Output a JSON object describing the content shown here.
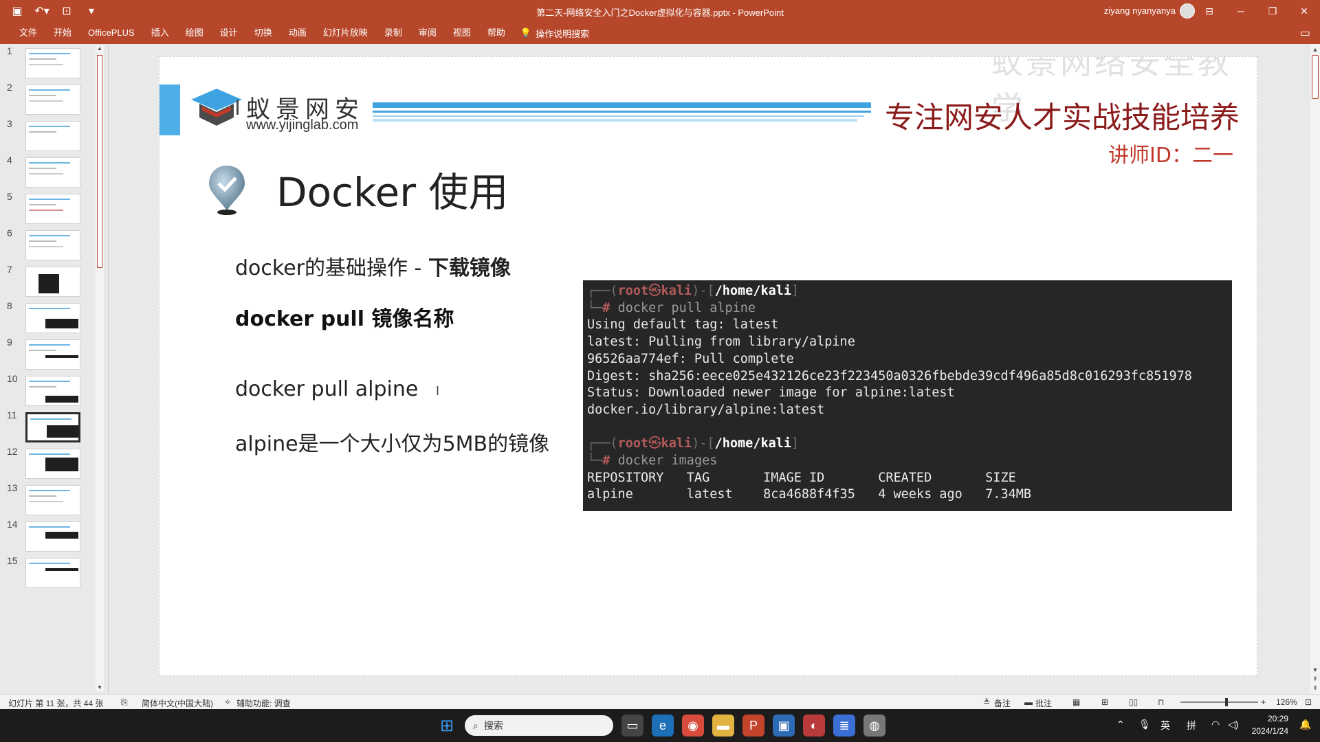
{
  "window": {
    "title": "第二天-网络安全入门之Docker虚拟化与容器.pptx - PowerPoint",
    "user": "ziyang nyanyanya"
  },
  "ribbon": {
    "tabs": [
      "文件",
      "开始",
      "OfficePLUS",
      "插入",
      "绘图",
      "设计",
      "切换",
      "动画",
      "幻灯片放映",
      "录制",
      "审阅",
      "视图",
      "帮助"
    ],
    "tell_me": "操作说明搜索"
  },
  "thumbnails": {
    "numbers": [
      "1",
      "2",
      "3",
      "4",
      "5",
      "6",
      "7",
      "8",
      "9",
      "10",
      "11",
      "12",
      "13",
      "14",
      "15"
    ],
    "selected": "11"
  },
  "slide": {
    "brand_cn": "蚁景网安",
    "brand_url": "www.yijinglab.com",
    "slogan": "专注网安人才实战技能培养",
    "teacher": "讲师ID：二一",
    "watermark": "蚁景网络安全教学",
    "title": "Docker 使用",
    "bullet1_prefix": "docker的基础操作 - ",
    "bullet1_bold": "下载镜像",
    "bullet2": "docker pull 镜像名称",
    "bullet3": "docker pull alpine",
    "bullet4": "alpine是一个大小仅为5MB的镜像"
  },
  "terminal": {
    "prompt_user": "root",
    "prompt_host": "kali",
    "prompt_path": "/home/kali",
    "cmd1": "docker pull alpine",
    "out1": "Using default tag: latest",
    "out2": "latest: Pulling from library/alpine",
    "out3": "96526aa774ef: Pull complete",
    "out4": "Digest: sha256:eece025e432126ce23f223450a0326fbebde39cdf496a85d8c016293fc851978",
    "out5": "Status: Downloaded newer image for alpine:latest",
    "out6": "docker.io/library/alpine:latest",
    "cmd2": "docker images",
    "table_header": "REPOSITORY   TAG       IMAGE ID       CREATED       SIZE",
    "table_row": "alpine       latest    8ca4688f4f35   4 weeks ago   7.34MB"
  },
  "statusbar": {
    "slide_info": "幻灯片 第 11 张，共 44 张",
    "language": "简体中文(中国大陆)",
    "accessibility": "辅助功能: 调查",
    "notes": "备注",
    "comments": "批注",
    "zoom": "126%"
  },
  "taskbar": {
    "search_placeholder": "搜索",
    "ime_lang": "英",
    "ime_mode": "拼",
    "time": "20:29",
    "date": "2024/1/24"
  },
  "colors": {
    "accent": "#b7472a",
    "logo_blue": "#4eaee8",
    "slogan_red": "#8b1a1a",
    "terminal_bg": "#262626"
  }
}
